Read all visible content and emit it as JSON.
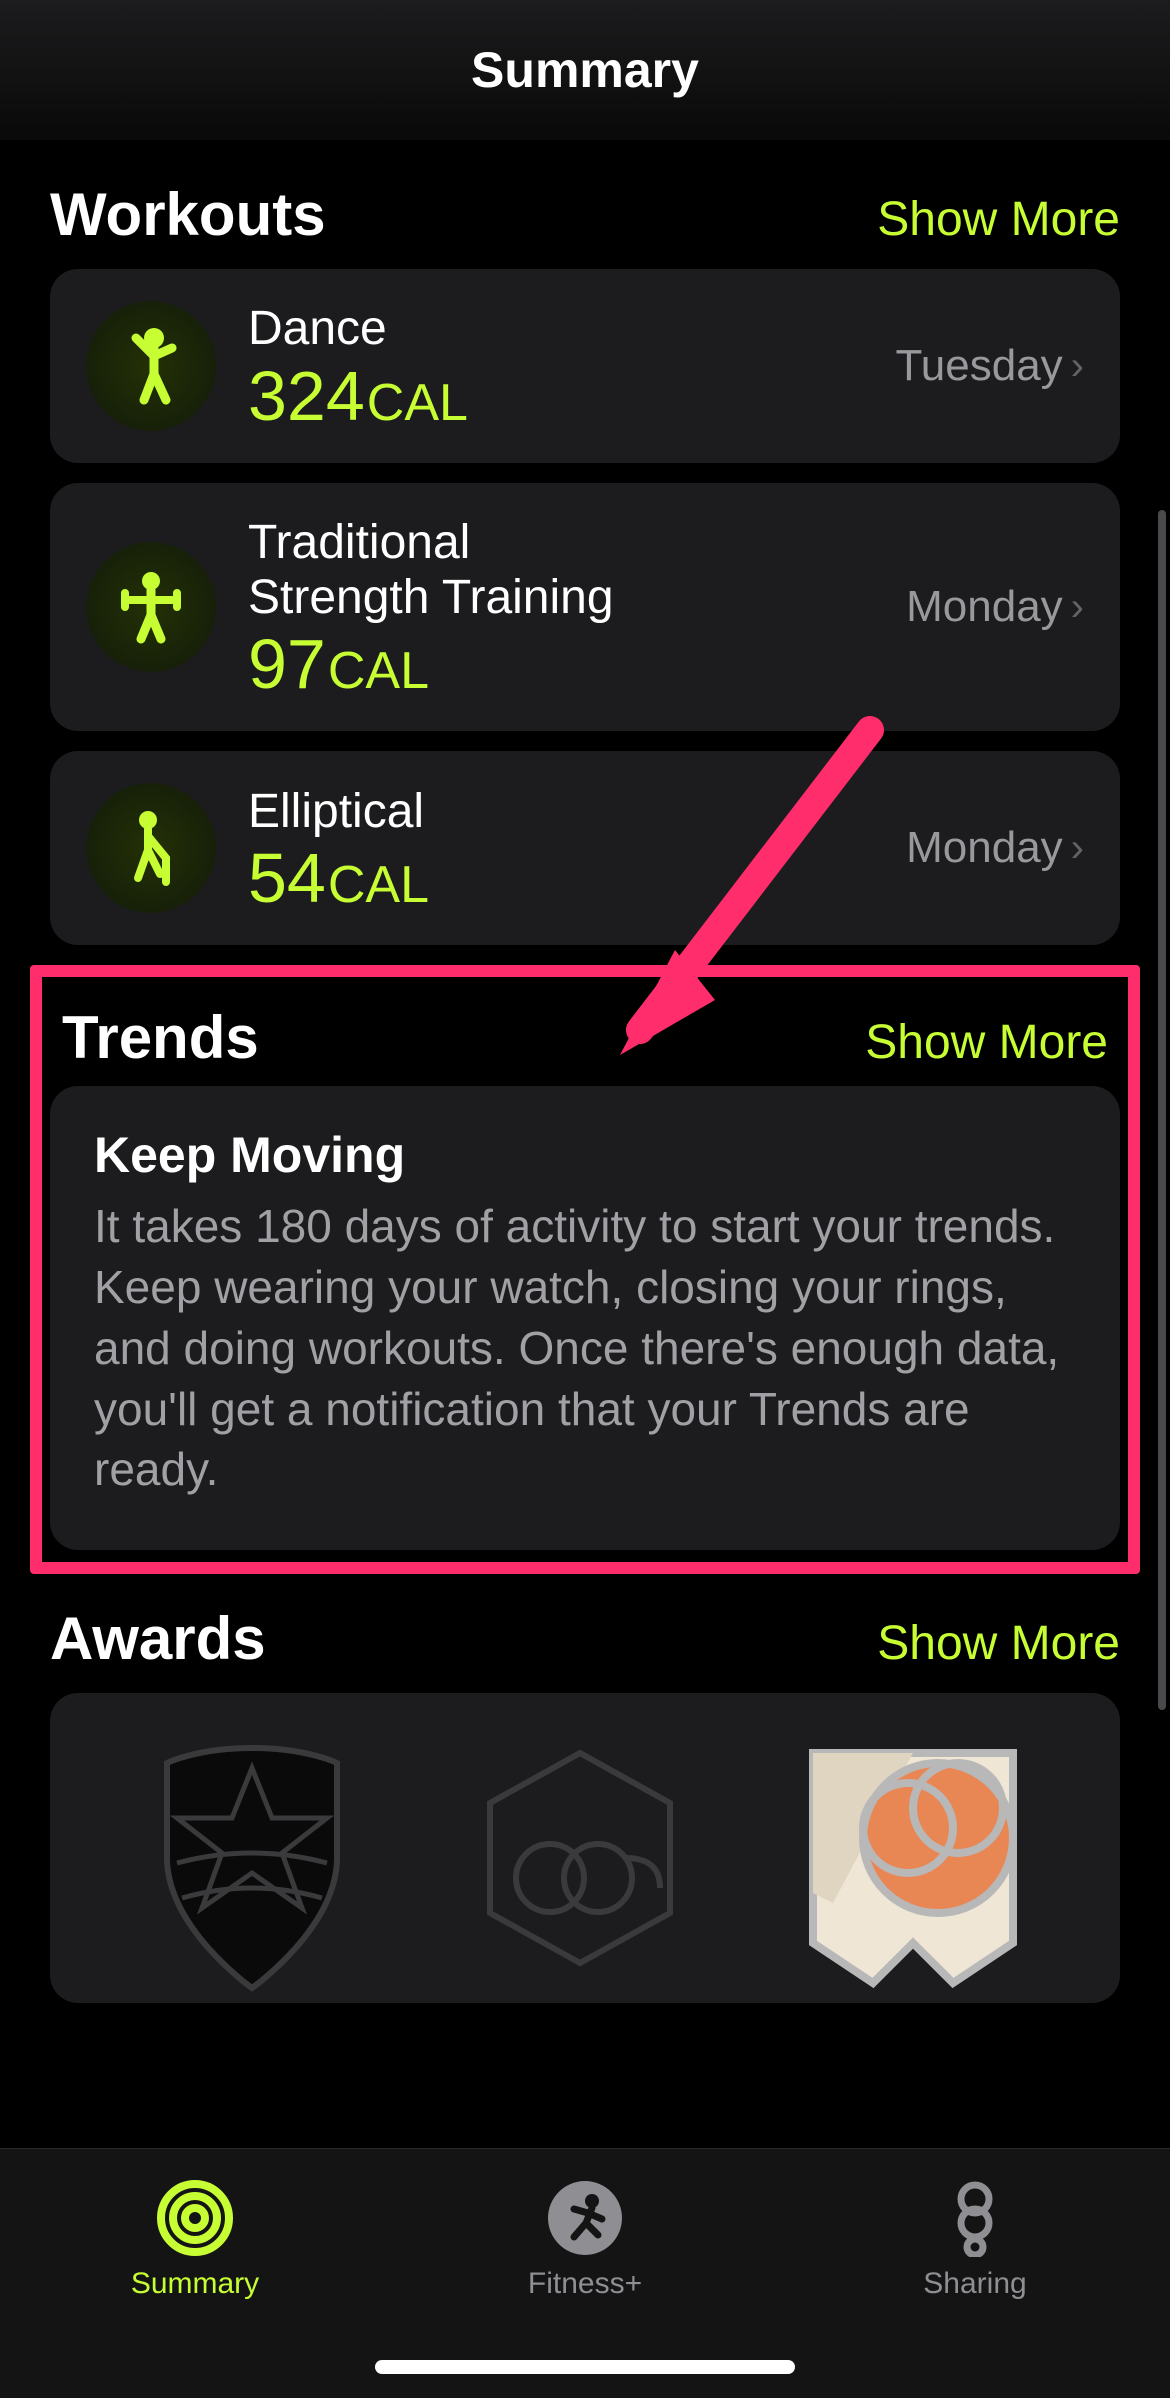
{
  "nav": {
    "title": "Summary"
  },
  "sections": {
    "workouts": {
      "title": "Workouts",
      "show_more": "Show More",
      "items": [
        {
          "name": "Dance",
          "value": "324",
          "unit": "CAL",
          "day": "Tuesday",
          "icon": "dance"
        },
        {
          "name": "Traditional\nStrength Training",
          "value": "97",
          "unit": "CAL",
          "day": "Monday",
          "icon": "strength"
        },
        {
          "name": "Elliptical",
          "value": "54",
          "unit": "CAL",
          "day": "Monday",
          "icon": "elliptical"
        }
      ]
    },
    "trends": {
      "title": "Trends",
      "show_more": "Show More",
      "card_title": "Keep Moving",
      "card_body": "It takes 180 days of activity to start your trends. Keep wearing your watch, closing your rings, and doing workouts. Once there's enough data, you'll get a notification that your Trends are ready."
    },
    "awards": {
      "title": "Awards",
      "show_more": "Show More"
    }
  },
  "tabs": {
    "summary": "Summary",
    "fitness": "Fitness+",
    "sharing": "Sharing"
  },
  "colors": {
    "accent": "#c7fd33",
    "annotation": "#FF2D6C"
  }
}
